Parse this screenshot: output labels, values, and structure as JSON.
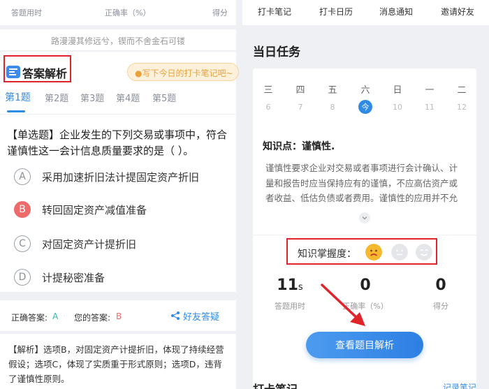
{
  "left": {
    "top_stats": {
      "time_label": "答题用时",
      "accuracy_label": "正确率（%）",
      "score_label": "得分"
    },
    "motto": "路漫漫其修远兮，锲而不舍金石可镂",
    "answer_header": {
      "title": "答案解析",
      "note_button": "●写下今日的打卡笔记吧~"
    },
    "tabs": [
      "第1题",
      "第2题",
      "第3题",
      "第4题",
      "第5题"
    ],
    "question": {
      "line1": "【单选题】企业发生的下列交易或事项中，符合",
      "line2": "谨慎性这一会计信息质量要求的是（   ）。",
      "options": [
        {
          "letter": "A",
          "text": "采用加速折旧法计提固定资产折旧"
        },
        {
          "letter": "B",
          "text": "转回固定资产减值准备"
        },
        {
          "letter": "C",
          "text": "对固定资产计提折旧"
        },
        {
          "letter": "D",
          "text": "计提秘密准备"
        }
      ]
    },
    "answer_bar": {
      "correct_label": "正确答案:",
      "correct_value": "A",
      "your_label": "您的答案:",
      "your_value": "B",
      "ask_friend": "好友答疑"
    },
    "analysis": {
      "line1": "【解析】选项B，对固定资产计提折旧，体现了持续经营",
      "line2": "假设；选项C，体现了实质重于形式原则；选项D，违背",
      "line3": "了谨慎性原则。"
    }
  },
  "right": {
    "top_nav": [
      "打卡笔记",
      "打卡日历",
      "消息通知",
      "邀请好友"
    ],
    "daily_task": "当日任务",
    "weekdays": [
      "三",
      "四",
      "五",
      "六",
      "日",
      "一",
      "二"
    ],
    "dates": [
      "6",
      "7",
      "8",
      "今",
      "10",
      "11",
      "12"
    ],
    "knowledge_title": "知识点：谨慎性.",
    "knowledge_body": {
      "line1": "谨慎性要求企业对交易或者事项进行会计确认、计",
      "line2": "量和报告时应当保持应有的谨慎，不应高估资产或",
      "line3": "者收益、低估负债或者费用。谨慎性的应用并不允"
    },
    "mastery_label": "知识掌握度：",
    "stats": [
      {
        "value": "11",
        "unit": "s",
        "label": "答题用时"
      },
      {
        "value": "0",
        "unit": "",
        "label": "正确率（%）"
      },
      {
        "value": "0",
        "unit": "",
        "label": "得分"
      }
    ],
    "view_button": "查看题目解析",
    "bottom_title": "打卡笔记",
    "bottom_link": "记录笔记"
  },
  "colors": {
    "accent_blue": "#2f8be6",
    "correct_teal": "#32b8a8",
    "wrong_red": "#ef6a6a",
    "highlight_red": "#e0242c"
  }
}
